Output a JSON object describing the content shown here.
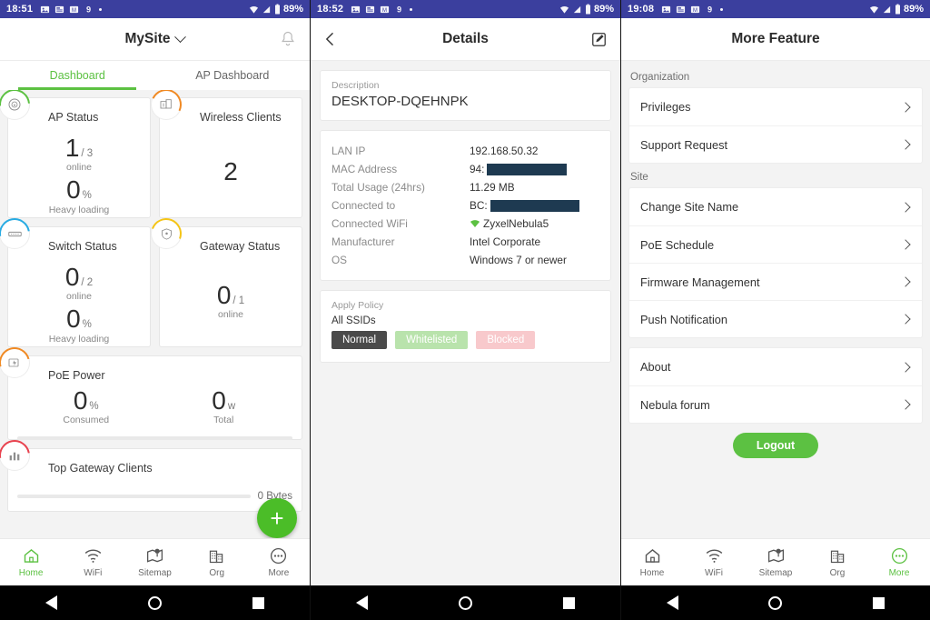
{
  "screen1": {
    "statusbar": {
      "time": "18:51",
      "battery": "89%",
      "icons": [
        "image-icon",
        "news-icon",
        "photos-icon",
        "app-icon",
        "dot-icon"
      ]
    },
    "appbar": {
      "title": "MySite",
      "dropdown_icon": "chevron-down-icon",
      "right_icon": "bell-icon"
    },
    "tabs": [
      {
        "label": "Dashboard",
        "active": true
      },
      {
        "label": "AP Dashboard",
        "active": false
      }
    ],
    "cards": [
      {
        "title": "AP Status",
        "icon": "access-point-icon",
        "arc_color": "#5cc142",
        "value": "1",
        "total": "/ 3",
        "value_label": "online",
        "secondary_value": "0",
        "secondary_unit": "%",
        "secondary_label": "Heavy loading"
      },
      {
        "title": "Wireless Clients",
        "icon": "wireless-clients-icon",
        "arc_color": "#f08a24",
        "value": "2"
      },
      {
        "title": "Switch Status",
        "icon": "switch-icon",
        "arc_color": "#29abe2",
        "value": "0",
        "total": "/ 2",
        "value_label": "online",
        "secondary_value": "0",
        "secondary_unit": "%",
        "secondary_label": "Heavy loading"
      },
      {
        "title": "Gateway Status",
        "icon": "gateway-shield-icon",
        "arc_color": "#f5c518",
        "value": "0",
        "total": "/ 1",
        "value_label": "online"
      },
      {
        "title": "PoE Power",
        "icon": "poe-power-icon",
        "arc_color": "#f08a24",
        "consumed_value": "0",
        "consumed_unit": "%",
        "consumed_label": "Consumed",
        "total_value": "0",
        "total_unit": "w",
        "total_label": "Total"
      },
      {
        "title": "Top Gateway Clients",
        "icon": "bar-chart-icon",
        "arc_color": "#e8434f",
        "bar_value": "0 Bytes"
      }
    ],
    "fab": {
      "icon": "plus-icon",
      "label": "+"
    },
    "bottomnav": [
      {
        "label": "Home",
        "icon": "home-icon",
        "active": true
      },
      {
        "label": "WiFi",
        "icon": "wifi-icon",
        "active": false
      },
      {
        "label": "Sitemap",
        "icon": "sitemap-icon",
        "active": false
      },
      {
        "label": "Org",
        "icon": "building-icon",
        "active": false
      },
      {
        "label": "More",
        "icon": "more-dots-icon",
        "active": false
      }
    ]
  },
  "screen2": {
    "statusbar": {
      "time": "18:52",
      "battery": "89%"
    },
    "appbar": {
      "title": "Details",
      "back_icon": "back-chevron-icon",
      "edit_icon": "edit-pencil-icon"
    },
    "description": {
      "label": "Description",
      "value": "DESKTOP-DQEHNPK"
    },
    "info_rows": [
      {
        "key": "LAN IP",
        "value": "192.168.50.32",
        "redacted": false
      },
      {
        "key": "MAC Address",
        "value": "94:",
        "redacted": true,
        "redact_width": 88
      },
      {
        "key": "Total Usage (24hrs)",
        "value": "11.29 MB",
        "redacted": false
      },
      {
        "key": "Connected to",
        "value": "BC:",
        "redacted": true,
        "redact_width": 98
      },
      {
        "key": "Connected WiFi",
        "value": "ZyxelNebula5",
        "redacted": false,
        "icon": "wifi-green-icon"
      },
      {
        "key": "Manufacturer",
        "value": "Intel Corporate",
        "redacted": false
      },
      {
        "key": "OS",
        "value": "Windows 7 or newer",
        "redacted": false
      }
    ],
    "policy": {
      "label": "Apply Policy",
      "ssid_label": "All SSIDs",
      "chips": [
        {
          "label": "Normal",
          "state": "selected"
        },
        {
          "label": "Whitelisted",
          "state": "green"
        },
        {
          "label": "Blocked",
          "state": "red"
        }
      ]
    }
  },
  "screen3": {
    "statusbar": {
      "time": "19:08",
      "battery": "89%"
    },
    "appbar": {
      "title": "More Feature"
    },
    "groups": [
      {
        "label": "Organization",
        "items": [
          "Privileges",
          "Support Request"
        ]
      },
      {
        "label": "Site",
        "items": [
          "Change Site Name",
          "PoE Schedule",
          "Firmware Management",
          "Push Notification"
        ]
      },
      {
        "label": "",
        "items": [
          "About",
          "Nebula forum"
        ]
      }
    ],
    "logout": {
      "label": "Logout",
      "color": "#5cc142"
    },
    "bottomnav": [
      {
        "label": "Home",
        "icon": "home-icon",
        "active": false
      },
      {
        "label": "WiFi",
        "icon": "wifi-icon",
        "active": false
      },
      {
        "label": "Sitemap",
        "icon": "sitemap-icon",
        "active": false
      },
      {
        "label": "Org",
        "icon": "building-icon",
        "active": false
      },
      {
        "label": "More",
        "icon": "more-dots-icon",
        "active": true
      }
    ]
  },
  "colors": {
    "statusbar": "#3b3f9e",
    "accent_green": "#5cc142",
    "fab_green": "#4bbd28"
  }
}
